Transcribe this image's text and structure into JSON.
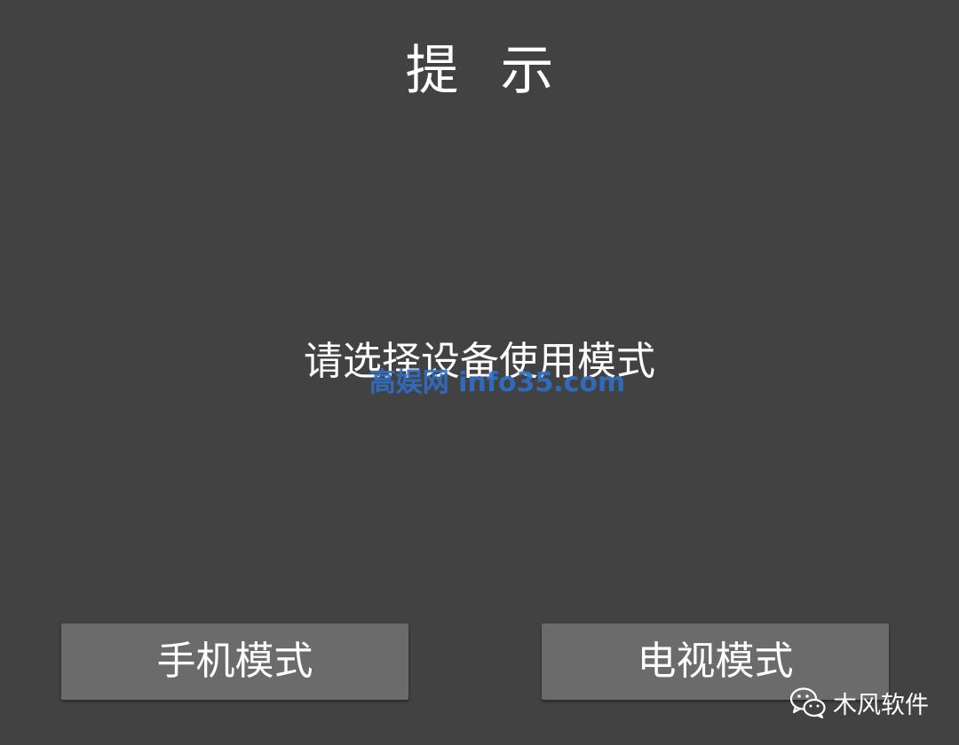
{
  "dialog": {
    "title": "提 示",
    "message": "请选择设备使用模式",
    "buttons": {
      "phone_mode": "手机模式",
      "tv_mode": "电视模式"
    }
  },
  "watermark": {
    "text": "高娱网 info35.com"
  },
  "brand": {
    "icon": "wechat-icon",
    "label": "木风软件"
  },
  "colors": {
    "background": "#424242",
    "button": "#6b6b6b",
    "text": "#ffffff",
    "watermark": "#2f6fc7"
  }
}
